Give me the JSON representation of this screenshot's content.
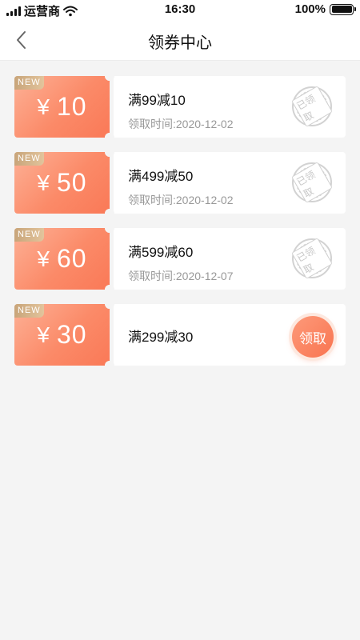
{
  "status_bar": {
    "carrier": "运营商",
    "time": "16:30",
    "battery": "100%",
    "icons": [
      "signal-icon",
      "wifi-icon",
      "battery-icon"
    ]
  },
  "nav": {
    "title": "领券中心",
    "back_icon": "chevron-left-icon"
  },
  "colors": {
    "accent": "#fa7957",
    "accent_light": "#fdb196",
    "badge_gold": "#d4b184",
    "background": "#f4f4f4"
  },
  "coupons": [
    {
      "badge": "NEW",
      "currency": "¥",
      "amount": "10",
      "title": "满99减10",
      "date": "领取时间:2020-12-02",
      "stamp": "已领取"
    },
    {
      "badge": "NEW",
      "currency": "¥",
      "amount": "50",
      "title": "满499减50",
      "date": "领取时间:2020-12-02",
      "stamp": "已领取"
    },
    {
      "badge": "NEW",
      "currency": "¥",
      "amount": "60",
      "title": "满599减60",
      "date": "领取时间:2020-12-07",
      "stamp": "已领取"
    },
    {
      "badge": "NEW",
      "currency": "¥",
      "amount": "30",
      "title": "满299减30",
      "action": "领取"
    }
  ]
}
